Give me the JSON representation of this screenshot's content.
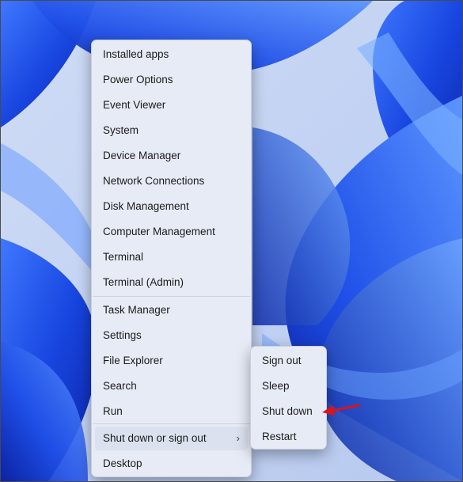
{
  "context_menu": {
    "items": [
      {
        "label": "Installed apps"
      },
      {
        "label": "Power Options"
      },
      {
        "label": "Event Viewer"
      },
      {
        "label": "System"
      },
      {
        "label": "Device Manager"
      },
      {
        "label": "Network Connections"
      },
      {
        "label": "Disk Management"
      },
      {
        "label": "Computer Management"
      },
      {
        "label": "Terminal"
      },
      {
        "label": "Terminal (Admin)"
      },
      {
        "label": "Task Manager"
      },
      {
        "label": "Settings"
      },
      {
        "label": "File Explorer"
      },
      {
        "label": "Search"
      },
      {
        "label": "Run"
      },
      {
        "label": "Shut down or sign out"
      },
      {
        "label": "Desktop"
      }
    ],
    "submenu_chevron": "›"
  },
  "shutdown_submenu": {
    "items": [
      {
        "label": "Sign out"
      },
      {
        "label": "Sleep"
      },
      {
        "label": "Shut down"
      },
      {
        "label": "Restart"
      }
    ]
  },
  "annotation": {
    "arrow_color": "#d9141c",
    "points_to": "Shut down"
  },
  "theme": {
    "wallpaper_base": "#1c3fd6",
    "wallpaper_light": "#4a86ff",
    "wallpaper_bg": "#d9e3f7",
    "menu_bg": "#e7ebf5"
  }
}
